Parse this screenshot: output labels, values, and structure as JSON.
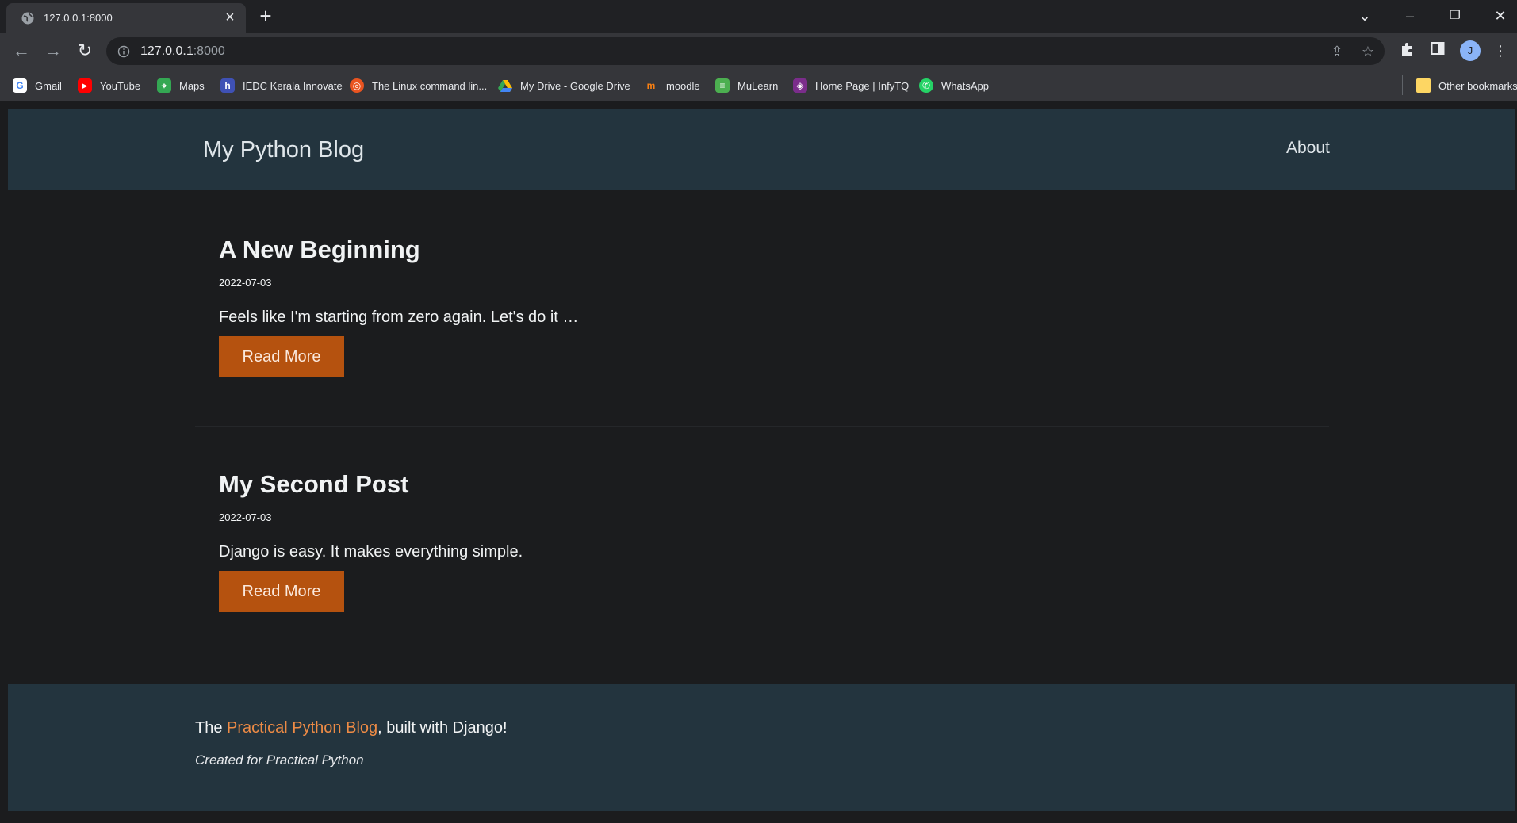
{
  "browser": {
    "tab_title": "127.0.0.1:8000",
    "address_host": "127.0.0.1",
    "address_port": ":8000",
    "profile_initial": "J",
    "bookmarks": [
      {
        "label": "Gmail",
        "icon": "google-icon",
        "color": "#ffffff"
      },
      {
        "label": "YouTube",
        "icon": "youtube-icon",
        "color": "#ff0000"
      },
      {
        "label": "Maps",
        "icon": "maps-icon",
        "color": "#34a853"
      },
      {
        "label": "IEDC Kerala Innovate",
        "icon": "iedc-icon",
        "color": "#3f51b5"
      },
      {
        "label": "The Linux command lin...",
        "icon": "ubuntu-icon",
        "color": "#e95420"
      },
      {
        "label": "My Drive - Google Drive",
        "icon": "drive-icon",
        "color": "#fbbc04"
      },
      {
        "label": "moodle",
        "icon": "moodle-icon",
        "color": "#f98012"
      },
      {
        "label": "MuLearn",
        "icon": "mulearn-icon",
        "color": "#4caf50"
      },
      {
        "label": "Home Page | InfyTQ",
        "icon": "infytq-icon",
        "color": "#7b2d8b"
      },
      {
        "label": "WhatsApp",
        "icon": "whatsapp-icon",
        "color": "#25d366"
      }
    ],
    "other_bookmarks": "Other bookmarks"
  },
  "site": {
    "title": "My Python Blog",
    "nav_about": "About"
  },
  "posts": [
    {
      "title": "A New Beginning",
      "date": "2022-07-03",
      "excerpt": "Feels like I'm starting from zero again. Let's do it …",
      "button": "Read More"
    },
    {
      "title": "My Second Post",
      "date": "2022-07-03",
      "excerpt": "Django is easy. It makes everything simple.",
      "button": "Read More"
    }
  ],
  "footer": {
    "prefix": "The ",
    "link": "Practical Python Blog",
    "suffix": ", built with Django!",
    "subtitle": "Created for Practical Python"
  },
  "colors": {
    "header_bg": "#23343e",
    "button_bg": "#b5520f",
    "link": "#ee8b45",
    "page_bg": "#1b1c1e"
  }
}
